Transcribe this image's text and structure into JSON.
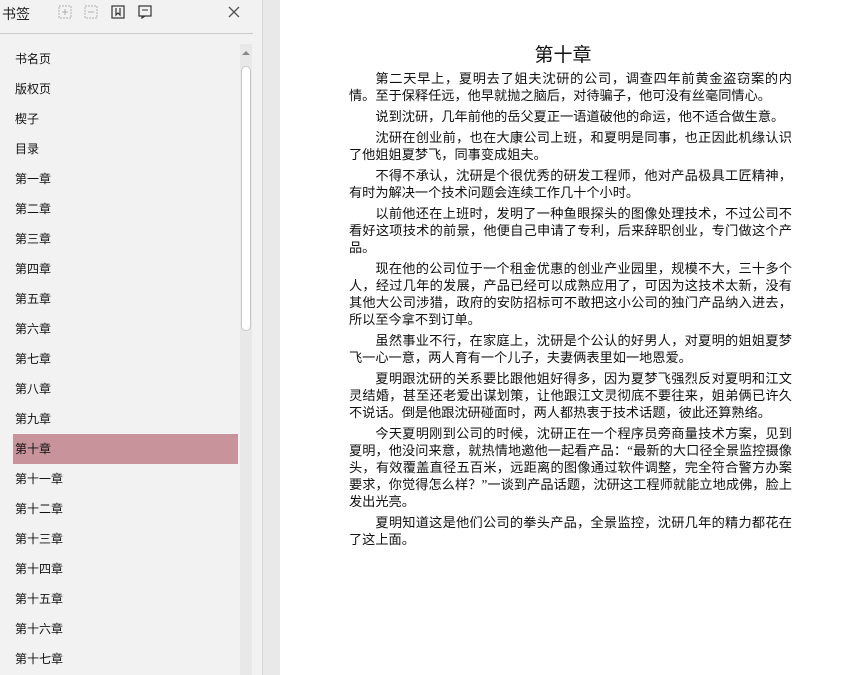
{
  "sidebar": {
    "title": "书签",
    "toolbar": [
      {
        "name": "expand-all-icon"
      },
      {
        "name": "collapse-all-icon"
      },
      {
        "name": "add-bookmark-icon"
      },
      {
        "name": "bookmark-options-icon"
      }
    ],
    "items": [
      {
        "label": "书名页"
      },
      {
        "label": "版权页"
      },
      {
        "label": "楔子"
      },
      {
        "label": "目录"
      },
      {
        "label": "第一章"
      },
      {
        "label": "第二章"
      },
      {
        "label": "第三章"
      },
      {
        "label": "第四章"
      },
      {
        "label": "第五章"
      },
      {
        "label": "第六章"
      },
      {
        "label": "第七章"
      },
      {
        "label": "第八章"
      },
      {
        "label": "第九章"
      },
      {
        "label": "第十章"
      },
      {
        "label": "第十一章"
      },
      {
        "label": "第十二章"
      },
      {
        "label": "第十三章"
      },
      {
        "label": "第十四章"
      },
      {
        "label": "第十五章"
      },
      {
        "label": "第十六章"
      },
      {
        "label": "第十七章"
      }
    ],
    "active_index": 13,
    "active_color": "#c8939a"
  },
  "page": {
    "chapter_title": "第十章",
    "paragraphs": [
      "第二天早上，夏明去了姐夫沈研的公司，调查四年前黄金盗窃案的内情。至于保释任远，他早就抛之脑后，对待骗子，他可没有丝毫同情心。",
      "说到沈研，几年前他的岳父夏正一语道破他的命运，他不适合做生意。",
      "沈研在创业前，也在大康公司上班，和夏明是同事，也正因此机缘认识了他姐姐夏梦飞，同事变成姐夫。",
      "不得不承认，沈研是个很优秀的研发工程师，他对产品极具工匠精神，有时为解决一个技术问题会连续工作几十个小时。",
      "以前他还在上班时，发明了一种鱼眼探头的图像处理技术，不过公司不看好这项技术的前景，他便自己申请了专利，后来辞职创业，专门做这个产品。",
      "现在他的公司位于一个租金优惠的创业产业园里，规模不大，三十多个人，经过几年的发展，产品已经可以成熟应用了，可因为这技术太新，没有其他大公司涉猎，政府的安防招标可不敢把这小公司的独门产品纳入进去，所以至今拿不到订单。",
      "虽然事业不行，在家庭上，沈研是个公认的好男人，对夏明的姐姐夏梦飞一心一意，两人育有一个儿子，夫妻俩表里如一地恩爱。",
      "夏明跟沈研的关系要比跟他姐好得多，因为夏梦飞强烈反对夏明和江文灵结婚，甚至还老爱出谋划策，让他跟江文灵彻底不要往来，姐弟俩已许久不说话。倒是他跟沈研碰面时，两人都热衷于技术话题，彼此还算熟络。",
      "今天夏明刚到公司的时候，沈研正在一个程序员旁商量技术方案，见到夏明，他没问来意，就热情地邀他一起看产品：“最新的大口径全景监控摄像头，有效覆盖直径五百米，远距离的图像通过软件调整，完全符合警方办案要求，你觉得怎么样？”一谈到产品话题，沈研这工程师就能立地成佛，脸上发出光亮。",
      "夏明知道这是他们公司的拳头产品，全景监控，沈研几年的精力都花在了这上面。"
    ]
  }
}
